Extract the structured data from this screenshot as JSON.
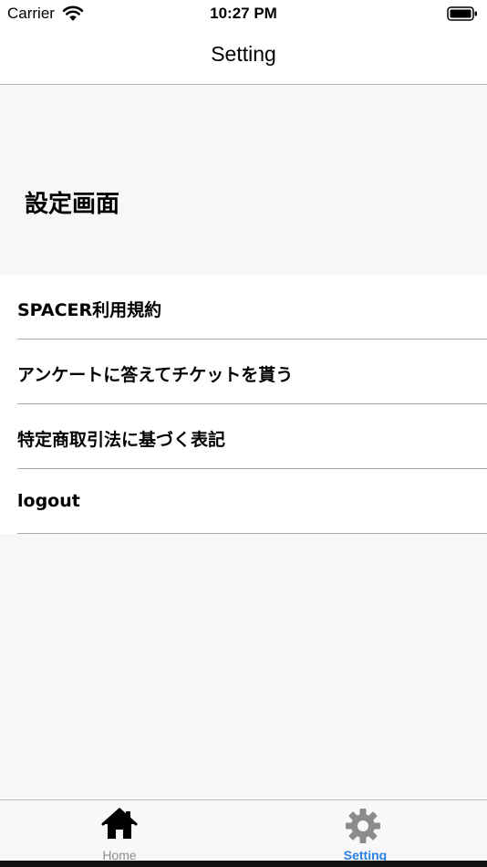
{
  "status_bar": {
    "carrier": "Carrier",
    "time": "10:27 PM"
  },
  "nav": {
    "title": "Setting"
  },
  "header": {
    "title": "設定画面"
  },
  "menu": {
    "items": [
      {
        "label": "SPACER利用規約"
      },
      {
        "label": "アンケートに答えてチケットを貰う"
      },
      {
        "label": "特定商取引法に基づく表記"
      },
      {
        "label": "logout"
      }
    ]
  },
  "tab_bar": {
    "tabs": [
      {
        "label": "Home",
        "icon": "home-icon",
        "selected": false
      },
      {
        "label": "Setting",
        "icon": "gear-icon",
        "selected": true
      }
    ],
    "active_color": "#2a7fe0",
    "inactive_color": "#8e8e8e"
  }
}
